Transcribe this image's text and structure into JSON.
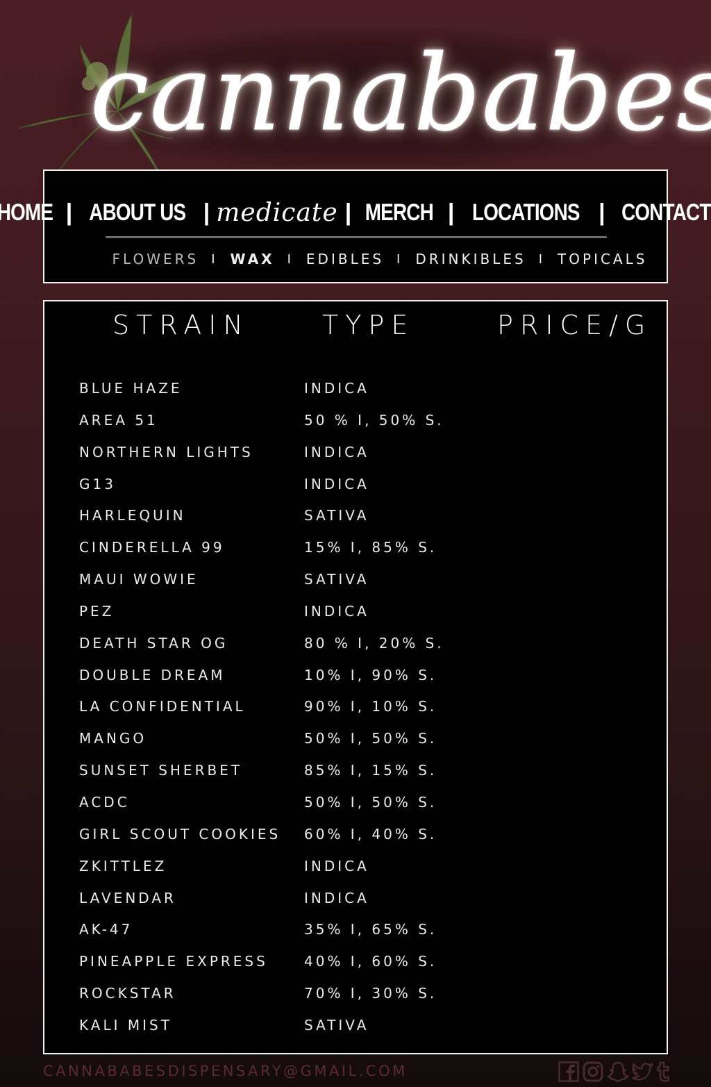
{
  "brand": {
    "logo_text": "cannababes"
  },
  "nav": {
    "items": [
      {
        "label": "HOME"
      },
      {
        "label": "ABOUT US"
      },
      {
        "label": "medicate",
        "active": true
      },
      {
        "label": "MERCH"
      },
      {
        "label": "LOCATIONS"
      },
      {
        "label": "CONTACT"
      }
    ],
    "separator": "|",
    "sub_items": [
      {
        "label": "FLOWERS",
        "current": true
      },
      {
        "label": "WAX"
      },
      {
        "label": "EDIBLES"
      },
      {
        "label": "DRINKIBLES"
      },
      {
        "label": "TOPICALS"
      }
    ],
    "sub_separator": "I"
  },
  "table": {
    "headers": {
      "strain": "STRAIN",
      "type": "TYPE",
      "price": "PRICE/G"
    },
    "rows": [
      {
        "strain": "BLUE HAZE",
        "type": "INDICA"
      },
      {
        "strain": "AREA 51",
        "type": "50 % I, 50% S."
      },
      {
        "strain": "NORTHERN LIGHTS",
        "type": "INDICA"
      },
      {
        "strain": "G13",
        "type": "INDICA"
      },
      {
        "strain": "HARLEQUIN",
        "type": "SATIVA"
      },
      {
        "strain": "CINDERELLA 99",
        "type": "15% I, 85% S."
      },
      {
        "strain": "MAUI WOWIE",
        "type": "SATIVA"
      },
      {
        "strain": "PEZ",
        "type": "INDICA"
      },
      {
        "strain": "DEATH STAR OG",
        "type": "80 % I, 20% S."
      },
      {
        "strain": "DOUBLE DREAM",
        "type": "10% I, 90% S."
      },
      {
        "strain": "LA CONFIDENTIAL",
        "type": "90% I, 10% S."
      },
      {
        "strain": "MANGO",
        "type": "50% I, 50% S."
      },
      {
        "strain": "SUNSET SHERBET",
        "type": "85% I, 15% S."
      },
      {
        "strain": "ACDC",
        "type": "50% I, 50% S."
      },
      {
        "strain": "GIRL SCOUT COOKIES",
        "type": "60% I, 40% S."
      },
      {
        "strain": "ZKITTLEZ",
        "type": "INDICA"
      },
      {
        "strain": "LAVENDAR",
        "type": "INDICA"
      },
      {
        "strain": "AK-47",
        "type": "35% I, 65% S."
      },
      {
        "strain": "PINEAPPLE EXPRESS",
        "type": "40% I, 60% S."
      },
      {
        "strain": "ROCKSTAR",
        "type": "70% I, 30% S."
      },
      {
        "strain": "KALI MIST",
        "type": "SATIVA"
      }
    ]
  },
  "footer": {
    "email": "CANNABABESDISPENSARY@GMAIL.COM",
    "social_icons": [
      "facebook-icon",
      "instagram-icon",
      "snapchat-icon",
      "twitter-icon",
      "tumblr-icon"
    ]
  },
  "colors": {
    "background_top": "#4a1e25",
    "background_bottom": "#140b0c",
    "panel": "#000000",
    "border": "#f2f2f2",
    "footer_text": "#5b2b31",
    "leaf": "#5a6b3a"
  }
}
